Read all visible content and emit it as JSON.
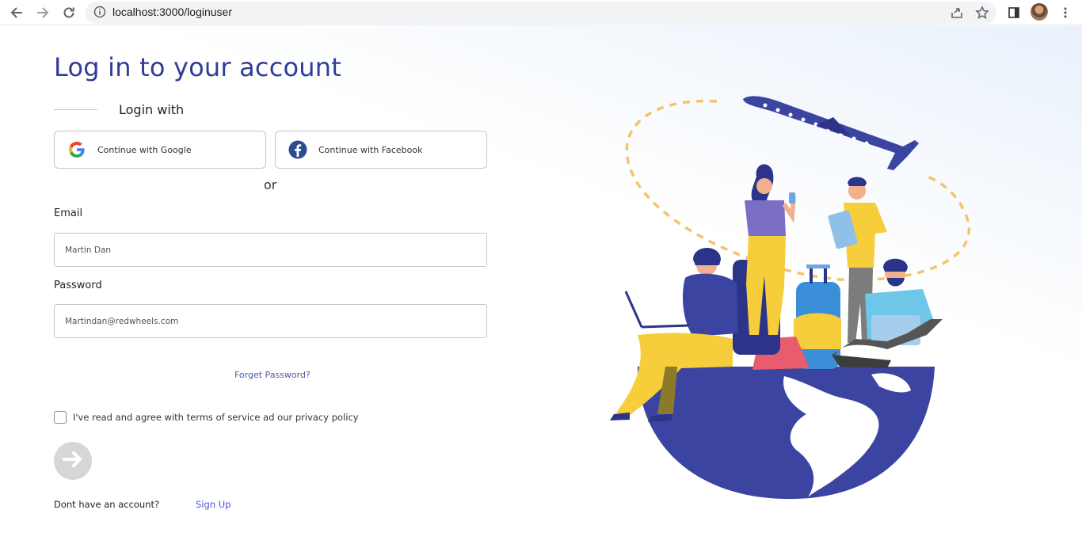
{
  "browser": {
    "url": "localhost:3000/loginuser",
    "icons": [
      "back-arrow-icon",
      "forward-arrow-icon",
      "reload-icon",
      "info-icon",
      "share-icon",
      "star-icon",
      "side-panel-icon",
      "profile-avatar",
      "kebab-menu-icon"
    ]
  },
  "login": {
    "title": "Log in to your account",
    "login_with": "Login with",
    "google_label": "Continue with Google",
    "facebook_label": "Continue with Facebook",
    "or": "or",
    "email_label": "Email",
    "email_value": "Martin Dan",
    "password_label": "Password",
    "password_value": "Martindan@redwheels.com",
    "forget_password": "Forget Password?",
    "terms": "I've read and agree with terms of service ad our privacy policy",
    "terms_checked": false,
    "no_account": "Dont have an account?",
    "sign_up": "Sign Up"
  },
  "colors": {
    "accent": "#2f3d97",
    "link": "#4b58c9",
    "illustration_blue": "#3b44a0",
    "illustration_yellow": "#f6cd3b"
  }
}
